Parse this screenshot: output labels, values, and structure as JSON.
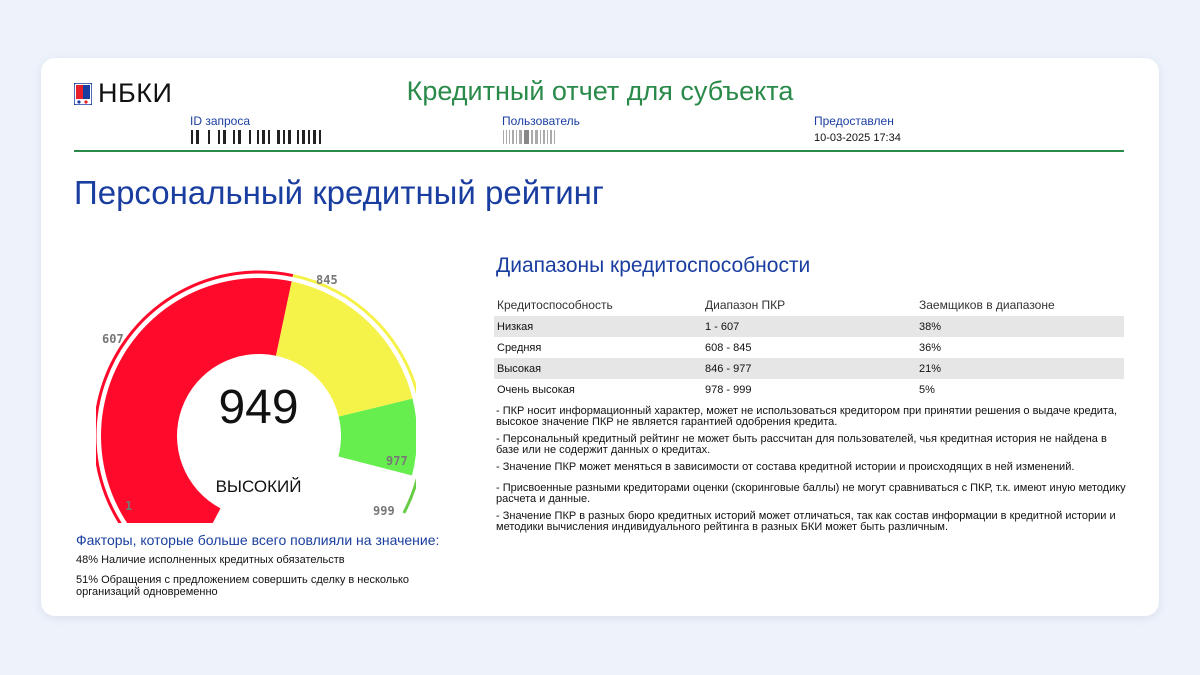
{
  "header": {
    "logo_text": "НБКИ",
    "title": "Кредитный отчет для субъекта",
    "request_id_label": "ID запроса",
    "user_label": "Пользователь",
    "provided_label": "Предоставлен",
    "provided_value": "10-03-2025 17:34"
  },
  "page_title": "Персональный кредитный рейтинг",
  "gauge": {
    "score": "949",
    "rating_label": "ВЫСОКИЙ",
    "min": 1,
    "max": 999,
    "ticks": [
      "1",
      "607",
      "845",
      "977",
      "999"
    ],
    "colors": {
      "low": "#ff0a2a",
      "medium": "#f5f24a",
      "high": "#66ee4f",
      "very_high": "#66cc44"
    }
  },
  "factors": {
    "title": "Факторы, которые больше всего повлияли на значение:",
    "items": [
      "48% Наличие исполненных кредитных обязательств",
      "51% Обращения с предложением совершить сделку в несколько организаций одновременно"
    ]
  },
  "ranges": {
    "title": "Диапазоны кредитоспособности",
    "headers": [
      "Кредитоспособность",
      "Диапазон ПКР",
      "Заемщиков в диапазоне"
    ],
    "rows": [
      [
        "Низкая",
        "1 - 607",
        "38%"
      ],
      [
        "Средняя",
        "608 - 845",
        "36%"
      ],
      [
        "Высокая",
        "846 - 977",
        "21%"
      ],
      [
        "Очень высокая",
        "978 - 999",
        "5%"
      ]
    ]
  },
  "notes": [
    "- ПКР носит информационный характер, может не использоваться кредитором при принятии решения о выдаче кредита, высокое значение ПКР не является гарантией одобрения кредита.",
    "- Персональный кредитный рейтинг не может быть рассчитан для пользователей, чья кредитная история не найдена в базе или не содержит данных о кредитах.",
    "- Значение ПКР может меняться в зависимости от состава кредитной истории и происходящих в ней изменений.",
    "- Присвоенные разными кредиторами оценки (скоринговые баллы) не могут сравниваться с ПКР, т.к. имеют иную методику расчета и данные.",
    "- Значение ПКР в разных бюро кредитных историй может отличаться, так как состав информации в кредитной истории и методики вычисления индивидуального рейтинга в разных БКИ может быть различным."
  ]
}
